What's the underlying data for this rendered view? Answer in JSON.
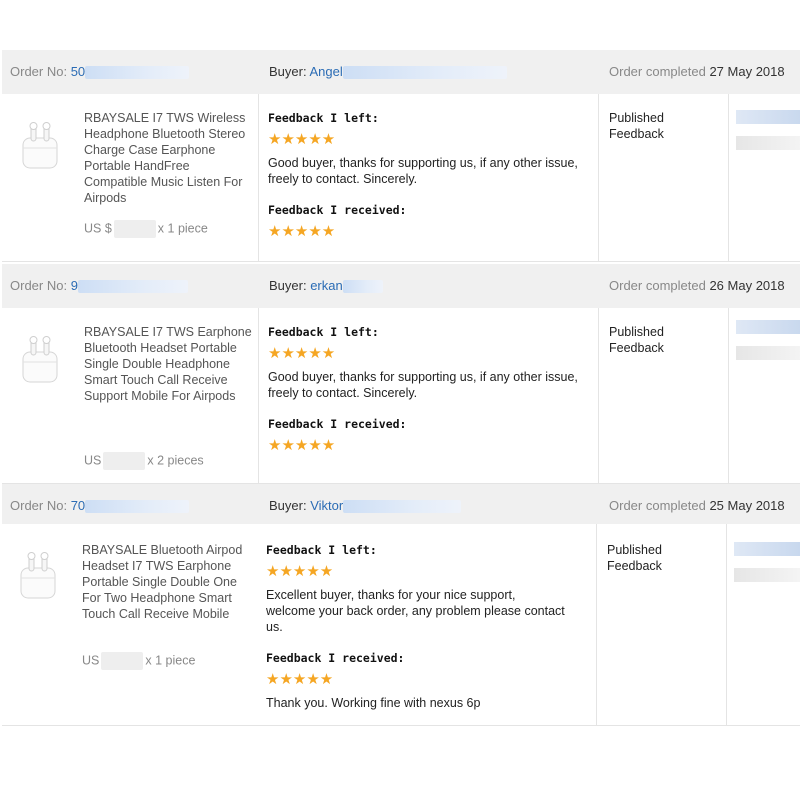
{
  "orders": [
    {
      "order_label": "Order No:",
      "order_no_visible": "50",
      "buyer_label": "Buyer:",
      "buyer_name": "Angel",
      "status_label": "Order completed",
      "completed_date": "27 May 2018",
      "product_title": "RBAYSALE I7 TWS Wireless Headphone Bluetooth Stereo Charge Case Earphone Portable HandFree Compatible Music Listen For Airpods",
      "price_prefix": "US $",
      "quantity": "x 1 piece",
      "feedback_left_label": "Feedback I left:",
      "feedback_left_stars": "★★★★★",
      "feedback_left_text": "Good buyer, thanks for supporting us, if any other issue, freely to contact. Sincerely.",
      "feedback_received_label": "Feedback I received:",
      "feedback_received_stars": "★★★★★",
      "feedback_received_text": "",
      "published": "Published Feedback"
    },
    {
      "order_label": "Order No:",
      "order_no_visible": "9",
      "buyer_label": "Buyer:",
      "buyer_name": "erkan",
      "status_label": "Order completed",
      "completed_date": "26 May 2018",
      "product_title": "RBAYSALE I7 TWS Earphone Bluetooth Headset Portable Single Double Headphone Smart Touch Call Receive Support Mobile For Airpods",
      "price_prefix": "US",
      "quantity": "x 2 pieces",
      "feedback_left_label": "Feedback I left:",
      "feedback_left_stars": "★★★★★",
      "feedback_left_text": "Good buyer, thanks for supporting us, if any other issue, freely to contact. Sincerely.",
      "feedback_received_label": "Feedback I received:",
      "feedback_received_stars": "★★★★★",
      "feedback_received_text": "",
      "published": "Published Feedback"
    },
    {
      "order_label": "Order No:",
      "order_no_visible": "70",
      "buyer_label": "Buyer:",
      "buyer_name": "Viktor",
      "status_label": "Order completed",
      "completed_date": "25 May 2018",
      "product_title": "RBAYSALE Bluetooth Airpod Headset I7 TWS Earphone Portable Single Double One For Two Headphone Smart Touch Call Receive Mobile",
      "price_prefix": "US",
      "quantity": "x 1 piece",
      "feedback_left_label": "Feedback I left:",
      "feedback_left_stars": "★★★★★",
      "feedback_left_text": "Excellent buyer, thanks for your nice support, welcome your back order, any problem please contact us.",
      "feedback_received_label": "Feedback I received:",
      "feedback_received_stars": "★★★★★",
      "feedback_received_text": "Thank you. Working fine with nexus 6p",
      "published": "Published Feedback"
    }
  ],
  "colors": {
    "header_bg": "#f0f0f0",
    "link": "#2b6cb5",
    "star": "#f5a623",
    "border": "#e4e4e4"
  },
  "icons": {
    "product_thumbnail": "earbuds-case-icon",
    "rating": "star-icon"
  }
}
